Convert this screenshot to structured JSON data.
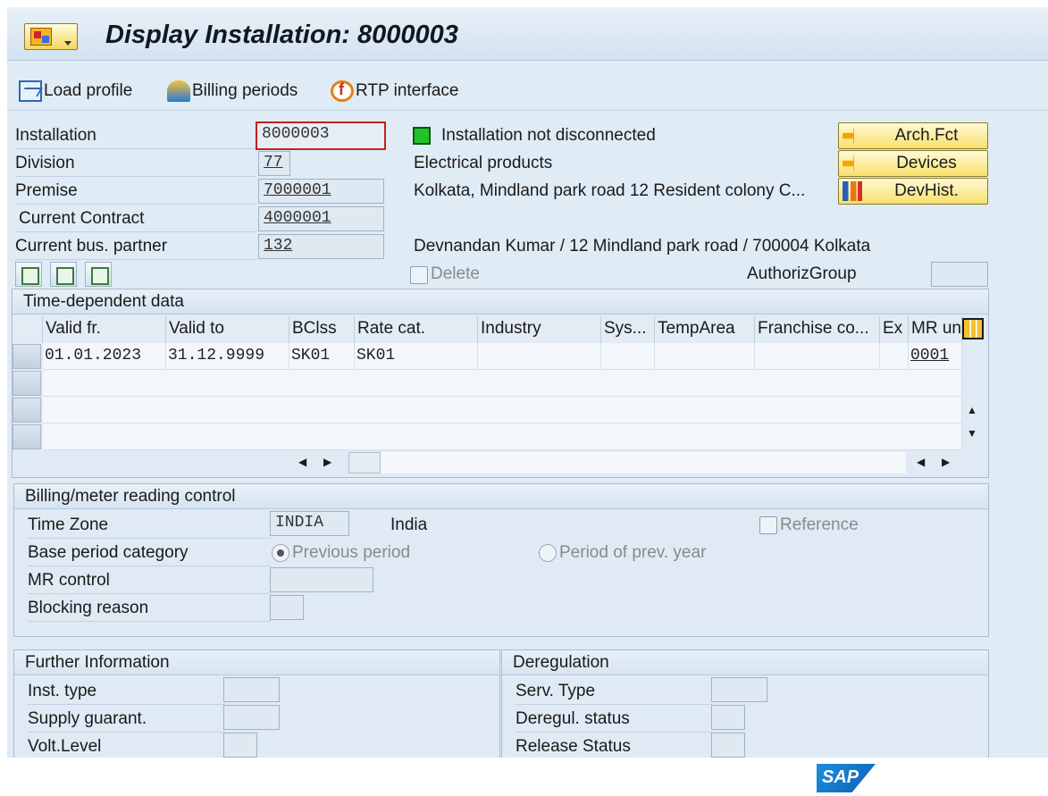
{
  "window": {
    "title": "Display Installation: 8000003"
  },
  "toolbar": {
    "load_profile": "Load profile",
    "billing_periods": "Billing periods",
    "rtp_interface": "RTP interface"
  },
  "header": {
    "installation_label": "Installation",
    "installation_value": "8000003",
    "division_label": "Division",
    "division_value": "77",
    "premise_label": "Premise",
    "premise_value": "7000001",
    "contract_label": "Current Contract",
    "contract_value": "4000001",
    "partner_label": "Current bus. partner",
    "partner_value": "132",
    "status_text": "Installation not disconnected",
    "division_text": "Electrical products",
    "premise_address": "Kolkata, Mindland park road  12  Resident colony  C...",
    "partner_text": "Devnandan Kumar / 12 Mindland park road / 700004 Kolkata",
    "delete_label": "Delete",
    "authoriz_label": "AuthorizGroup",
    "authoriz_value": "",
    "status_color": "#22c32a"
  },
  "buttons": {
    "arch_fct": "Arch.Fct",
    "devices": "Devices",
    "devhist": "DevHist."
  },
  "time_dependent": {
    "title": "Time-dependent data",
    "columns": [
      "Valid fr.",
      "Valid to",
      "BClss",
      "Rate cat.",
      "Industry",
      "Sys...",
      "TempArea",
      "Franchise co...",
      "Ex",
      "MR un"
    ],
    "rows": [
      [
        "01.01.2023",
        "31.12.9999",
        "SK01",
        "SK01",
        "",
        "",
        "",
        "",
        "",
        "0001"
      ]
    ]
  },
  "billing": {
    "title": "Billing/meter reading control",
    "time_zone_label": "Time Zone",
    "time_zone_value": "INDIA",
    "time_zone_text": "India",
    "reference_label": "Reference",
    "base_period_label": "Base period category",
    "previous_period": "Previous period",
    "prev_year": "Period of prev. year",
    "mr_control_label": "MR control",
    "mr_control_value": "",
    "blocking_label": "Blocking reason",
    "blocking_value": ""
  },
  "further": {
    "title": "Further Information",
    "inst_type_label": "Inst. type",
    "supply_label": "Supply guarant.",
    "volt_label": "Volt.Level"
  },
  "deregulation": {
    "title": "Deregulation",
    "serv_type_label": "Serv. Type",
    "dereg_status_label": "Deregul. status",
    "release_status_label": "Release Status"
  },
  "footer": {
    "logo": "SAP"
  }
}
